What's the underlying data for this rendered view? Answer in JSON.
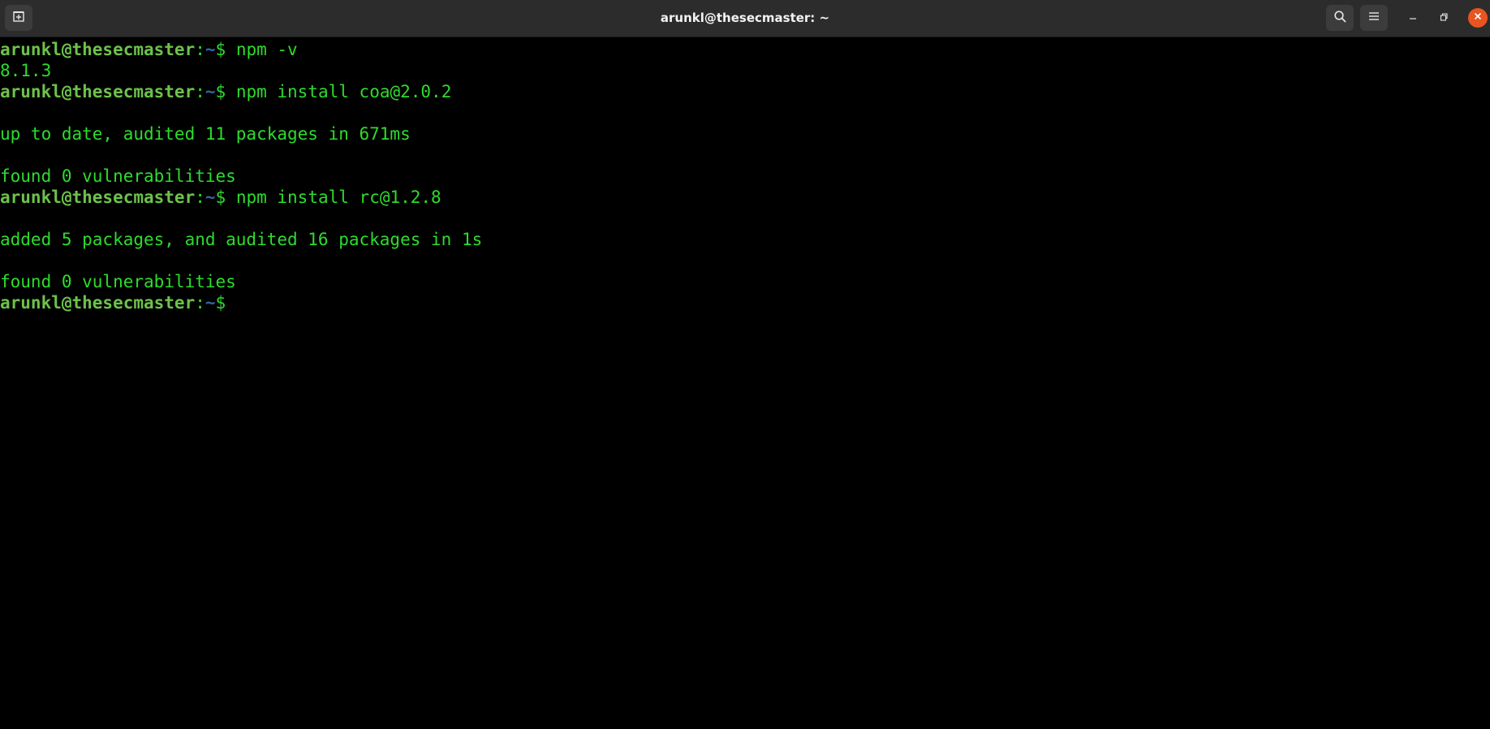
{
  "window": {
    "title": "arunkl@thesecmaster: ~"
  },
  "icons": {
    "new_tab": "new-tab-icon",
    "search": "search-icon",
    "menu": "hamburger-menu-icon",
    "minimize": "minimize-icon",
    "maximize": "maximize-icon",
    "close": "close-icon"
  },
  "colors": {
    "user_host": "#6cc24a",
    "path": "#3465a4",
    "output": "#2ddc2d",
    "close_button": "#e95420"
  },
  "prompt": {
    "user_host": "arunkl@thesecmaster",
    "separator": ":",
    "path": "~",
    "symbol": "$ "
  },
  "terminal": {
    "lines": [
      {
        "type": "prompt",
        "command": "npm -v"
      },
      {
        "type": "output",
        "text": "8.1.3"
      },
      {
        "type": "prompt",
        "command": "npm install coa@2.0.2"
      },
      {
        "type": "output",
        "text": ""
      },
      {
        "type": "output",
        "text": "up to date, audited 11 packages in 671ms"
      },
      {
        "type": "output",
        "text": ""
      },
      {
        "type": "output",
        "text": "found 0 vulnerabilities"
      },
      {
        "type": "prompt",
        "command": "npm install rc@1.2.8"
      },
      {
        "type": "output",
        "text": ""
      },
      {
        "type": "output",
        "text": "added 5 packages, and audited 16 packages in 1s"
      },
      {
        "type": "output",
        "text": ""
      },
      {
        "type": "output",
        "text": "found 0 vulnerabilities"
      },
      {
        "type": "prompt",
        "command": ""
      }
    ]
  }
}
